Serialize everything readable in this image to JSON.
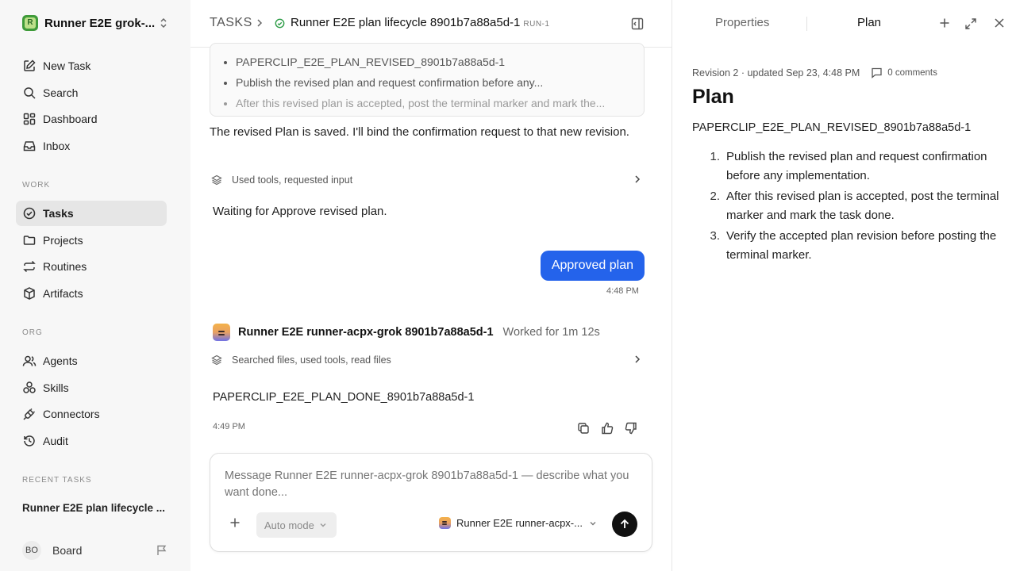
{
  "sidebar": {
    "workspace": {
      "name": "Runner E2E grok-...",
      "logo_letter": "R"
    },
    "nav_top": [
      {
        "label": "New Task",
        "icon": "pencil-square-icon"
      },
      {
        "label": "Search",
        "icon": "search-icon"
      },
      {
        "label": "Dashboard",
        "icon": "dashboard-grid-icon"
      },
      {
        "label": "Inbox",
        "icon": "inbox-icon"
      }
    ],
    "work_section": "WORK",
    "nav_work": [
      {
        "label": "Tasks",
        "icon": "check-circle-icon",
        "active": true
      },
      {
        "label": "Projects",
        "icon": "folder-icon"
      },
      {
        "label": "Routines",
        "icon": "repeat-icon"
      },
      {
        "label": "Artifacts",
        "icon": "box-icon"
      }
    ],
    "org_section": "ORG",
    "nav_org": [
      {
        "label": "Agents",
        "icon": "users-icon"
      },
      {
        "label": "Skills",
        "icon": "skills-icon"
      },
      {
        "label": "Connectors",
        "icon": "plug-icon"
      },
      {
        "label": "Audit",
        "icon": "history-icon"
      }
    ],
    "recent_section": "RECENT TASKS",
    "recent_task": "Runner E2E plan lifecycle ...",
    "board": {
      "initials": "BO",
      "label": "Board"
    }
  },
  "header": {
    "root": "TASKS",
    "title": "Runner E2E plan lifecycle 8901b7a88a5d-1",
    "run_badge": "RUN-1"
  },
  "chat": {
    "plan_items": [
      "PAPERCLIP_E2E_PLAN_REVISED_8901b7a88a5d-1",
      "Publish the revised plan and request confirmation before any...",
      "After this revised plan is accepted, post the terminal marker and mark the..."
    ],
    "assistant_message": "The revised Plan is saved. I'll bind the confirmation request to that new revision.",
    "tool_summary_1": "Used tools, requested input",
    "waiting_text": "Waiting for Approve revised plan.",
    "user_reply": "Approved plan",
    "user_time": "4:48 PM",
    "agent_name": "Runner E2E runner-acpx-grok 8901b7a88a5d-1",
    "worked_for": "Worked for 1m 12s",
    "tool_summary_2": "Searched files, used tools, read files",
    "done_marker": "PAPERCLIP_E2E_PLAN_DONE_8901b7a88a5d-1",
    "done_time": "4:49 PM"
  },
  "composer": {
    "placeholder": "Message Runner E2E runner-acpx-grok 8901b7a88a5d-1 — describe what you want done...",
    "mode": "Auto mode",
    "agent": "Runner E2E runner-acpx-..."
  },
  "panel": {
    "tabs": [
      "Properties",
      "Plan"
    ],
    "active_tab": "Plan",
    "revision": "Revision 2 · updated Sep 23, 4:48 PM",
    "comments": "0 comments",
    "title": "Plan",
    "marker": "PAPERCLIP_E2E_PLAN_REVISED_8901b7a88a5d-1",
    "steps": [
      {
        "num": "1.",
        "text": "Publish the revised plan and request confirmation before any implementation."
      },
      {
        "num": "2.",
        "text": "After this revised plan is accepted, post the terminal marker and mark the task done."
      },
      {
        "num": "3.",
        "text": "Verify the accepted plan revision before posting the terminal marker."
      }
    ]
  },
  "colors": {
    "accent_blue": "#2463eb",
    "status_green": "#2e9d48",
    "sidebar_bg": "#f7f7f7"
  }
}
